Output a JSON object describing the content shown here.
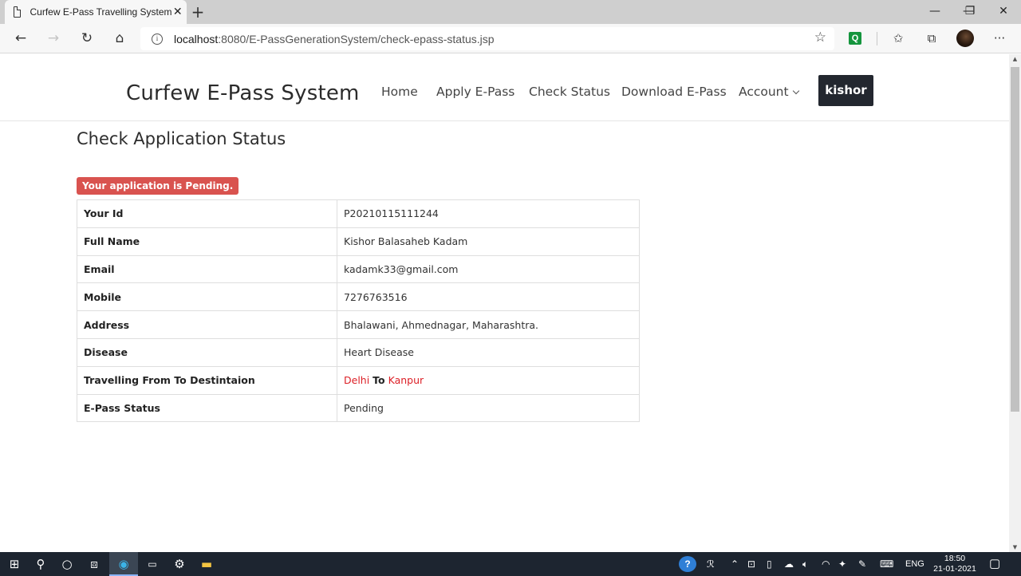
{
  "browser": {
    "tab_title": "Curfew E-Pass Travelling System",
    "tab_close": "✕",
    "new_tab": "+",
    "url_host": "localhost",
    "url_rest": ":8080/E-PassGenerationSystem/check-epass-status.jsp",
    "extension_label": "Q",
    "controls": {
      "minimize": "—",
      "maximize": "❐",
      "close": "✕"
    }
  },
  "navbar": {
    "brand": "Curfew E-Pass System",
    "links": [
      "Home",
      "Apply E-Pass",
      "Check Status",
      "Download E-Pass",
      "Account"
    ],
    "user": "kishor"
  },
  "page": {
    "title": "Check Application Status",
    "badge": "Your application is Pending.",
    "rows": [
      {
        "label": "Your Id",
        "value": "P20210115111244"
      },
      {
        "label": "Full Name",
        "value": "Kishor Balasaheb Kadam"
      },
      {
        "label": "Email",
        "value": "kadamk33@gmail.com"
      },
      {
        "label": "Mobile",
        "value": "7276763516"
      },
      {
        "label": "Address",
        "value": "Bhalawani, Ahmednagar, Maharashtra."
      },
      {
        "label": "Disease",
        "value": "Heart Disease"
      },
      {
        "label": "Travelling From To Destintaion",
        "from": "Delhi",
        "to_word": "To",
        "to": "Kanpur"
      },
      {
        "label": "E-Pass Status",
        "value": "Pending"
      }
    ]
  },
  "taskbar": {
    "language": "ENG",
    "time": "18:50",
    "date": "21-01-2021"
  },
  "colors": {
    "badge": "#d9534f",
    "destination_text": "#dc1f26",
    "user_button": "#23272f",
    "taskbar": "#1d2530"
  }
}
